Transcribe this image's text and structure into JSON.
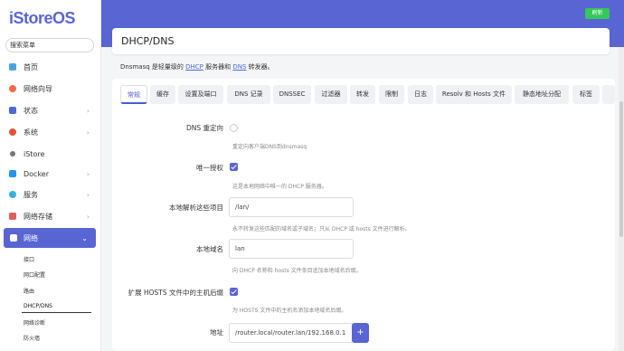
{
  "brand": {
    "logo": "iStoreOS"
  },
  "sidebar": {
    "search_placeholder": "搜索菜单",
    "items": [
      {
        "label": "首页",
        "chevron": ""
      },
      {
        "label": "网络向导",
        "chevron": ""
      },
      {
        "label": "状态",
        "chevron": "›"
      },
      {
        "label": "系统",
        "chevron": "›"
      },
      {
        "label": "iStore",
        "chevron": ""
      },
      {
        "label": "Docker",
        "chevron": "›"
      },
      {
        "label": "服务",
        "chevron": "›"
      },
      {
        "label": "网络存储",
        "chevron": "›"
      },
      {
        "label": "网络",
        "chevron": "⌄"
      }
    ],
    "subitems": [
      "接口",
      "网口配置",
      "路由",
      "DHCP/DNS",
      "网络诊断",
      "防火墙"
    ]
  },
  "topbar": {
    "refresh_label": "刷新"
  },
  "page": {
    "title": "DHCP/DNS",
    "desc_prefix": "Dnsmasq 是轻量级的 ",
    "desc_link1": "DHCP",
    "desc_mid": " 服务器和 ",
    "desc_link2": "DNS",
    "desc_suffix": " 转发器。"
  },
  "tabs": [
    "常规",
    "缓存",
    "设置及端口",
    "DNS 记录",
    "DNSSEC",
    "过滤器",
    "转发",
    "限制",
    "日志",
    "Resolv 和 Hosts 文件",
    "静态地址分配",
    "标签"
  ],
  "form": {
    "dns_rebind": {
      "label": "DNS 重定向",
      "help": "重定向客户端DNS到dnsmasq",
      "checked": false
    },
    "authoritative": {
      "label": "唯一授权",
      "help": "这是本地网络中唯一的 DHCP 服务器。",
      "checked": true
    },
    "local": {
      "label": "本地解析这些项目",
      "value": "/lan/",
      "help": "永不转发这些匹配的域名或子域名；只从 DHCP 或 hosts 文件进行解析。"
    },
    "domain": {
      "label": "本地域名",
      "value": "lan",
      "help": "向 DHCP 名称和 hosts 文件条目追加本地域名后缀。"
    },
    "expandhosts": {
      "label": "扩展 HOSTS 文件中的主机后缀",
      "help": "为 HOSTS 文件中的主机名添加本地域名后缀。",
      "checked": true
    },
    "address": {
      "label": "地址",
      "value": "/router.local/router.lan/192.168.0.1",
      "add_label": "+"
    }
  },
  "colors": {
    "accent": "#5865d2",
    "refresh": "#34c759"
  }
}
